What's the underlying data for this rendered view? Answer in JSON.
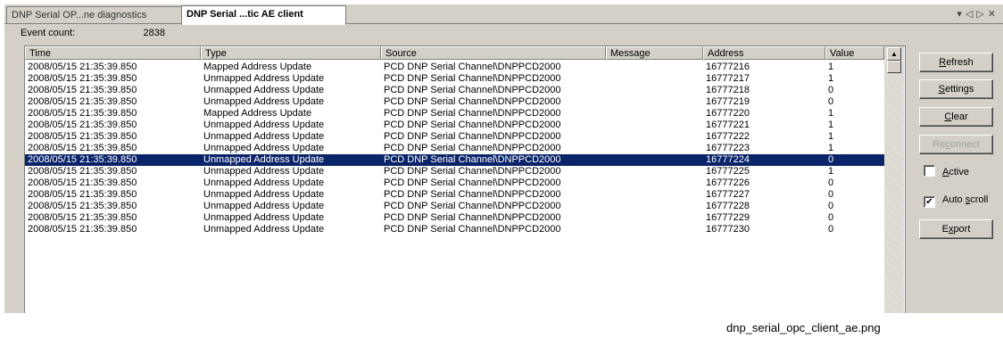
{
  "tabs": [
    {
      "label": "DNP Serial OP...ne diagnostics",
      "active": false
    },
    {
      "label": "DNP Serial ...tic AE client",
      "active": true
    }
  ],
  "tab_controls": {
    "dropdown": "▾",
    "prev": "◁",
    "next": "▷",
    "close": "✕"
  },
  "event_count": {
    "label": "Event count:",
    "value": "2838"
  },
  "table": {
    "columns": [
      "Time",
      "Type",
      "Source",
      "Message",
      "Address",
      "Value"
    ],
    "selected_index": 8,
    "rows": [
      {
        "time": "2008/05/15 21:35:39.850",
        "type": "Mapped Address Update",
        "source": "PCD DNP Serial Channel\\DNPPCD2000",
        "message": "",
        "address": "16777216",
        "value": "1"
      },
      {
        "time": "2008/05/15 21:35:39.850",
        "type": "Unmapped Address Update",
        "source": "PCD DNP Serial Channel\\DNPPCD2000",
        "message": "",
        "address": "16777217",
        "value": "1"
      },
      {
        "time": "2008/05/15 21:35:39.850",
        "type": "Unmapped Address Update",
        "source": "PCD DNP Serial Channel\\DNPPCD2000",
        "message": "",
        "address": "16777218",
        "value": "0"
      },
      {
        "time": "2008/05/15 21:35:39.850",
        "type": "Unmapped Address Update",
        "source": "PCD DNP Serial Channel\\DNPPCD2000",
        "message": "",
        "address": "16777219",
        "value": "0"
      },
      {
        "time": "2008/05/15 21:35:39.850",
        "type": "Mapped Address Update",
        "source": "PCD DNP Serial Channel\\DNPPCD2000",
        "message": "",
        "address": "16777220",
        "value": "1"
      },
      {
        "time": "2008/05/15 21:35:39.850",
        "type": "Unmapped Address Update",
        "source": "PCD DNP Serial Channel\\DNPPCD2000",
        "message": "",
        "address": "16777221",
        "value": "1"
      },
      {
        "time": "2008/05/15 21:35:39.850",
        "type": "Unmapped Address Update",
        "source": "PCD DNP Serial Channel\\DNPPCD2000",
        "message": "",
        "address": "16777222",
        "value": "1"
      },
      {
        "time": "2008/05/15 21:35:39.850",
        "type": "Unmapped Address Update",
        "source": "PCD DNP Serial Channel\\DNPPCD2000",
        "message": "",
        "address": "16777223",
        "value": "1"
      },
      {
        "time": "2008/05/15 21:35:39.850",
        "type": "Unmapped Address Update",
        "source": "PCD DNP Serial Channel\\DNPPCD2000",
        "message": "",
        "address": "16777224",
        "value": "0"
      },
      {
        "time": "2008/05/15 21:35:39.850",
        "type": "Unmapped Address Update",
        "source": "PCD DNP Serial Channel\\DNPPCD2000",
        "message": "",
        "address": "16777225",
        "value": "1"
      },
      {
        "time": "2008/05/15 21:35:39.850",
        "type": "Unmapped Address Update",
        "source": "PCD DNP Serial Channel\\DNPPCD2000",
        "message": "",
        "address": "16777226",
        "value": "0"
      },
      {
        "time": "2008/05/15 21:35:39.850",
        "type": "Unmapped Address Update",
        "source": "PCD DNP Serial Channel\\DNPPCD2000",
        "message": "",
        "address": "16777227",
        "value": "0"
      },
      {
        "time": "2008/05/15 21:35:39.850",
        "type": "Unmapped Address Update",
        "source": "PCD DNP Serial Channel\\DNPPCD2000",
        "message": "",
        "address": "16777228",
        "value": "0"
      },
      {
        "time": "2008/05/15 21:35:39.850",
        "type": "Unmapped Address Update",
        "source": "PCD DNP Serial Channel\\DNPPCD2000",
        "message": "",
        "address": "16777229",
        "value": "0"
      },
      {
        "time": "2008/05/15 21:35:39.850",
        "type": "Unmapped Address Update",
        "source": "PCD DNP Serial Channel\\DNPPCD2000",
        "message": "",
        "address": "16777230",
        "value": "0"
      }
    ]
  },
  "scrollbar": {
    "up_arrow": "▲"
  },
  "buttons": {
    "refresh": {
      "key": "R",
      "rest": "efresh"
    },
    "settings": {
      "key": "S",
      "rest": "ettings"
    },
    "clear": {
      "key": "C",
      "rest": "lear"
    },
    "reconnect": {
      "pre": "Re",
      "key": "c",
      "rest": "onnect",
      "enabled": false
    },
    "export": {
      "pre": "E",
      "key": "x",
      "rest": "port"
    }
  },
  "checkboxes": {
    "active": {
      "key": "A",
      "rest": "ctive",
      "checked": false
    },
    "autoscroll": {
      "pre": "Auto ",
      "key": "s",
      "rest": "croll",
      "checked": true,
      "mark": "✔"
    }
  },
  "caption": "dnp_serial_opc_client_ae.png",
  "colors": {
    "selection": "#0a246a",
    "window": "#d4d0c8"
  }
}
